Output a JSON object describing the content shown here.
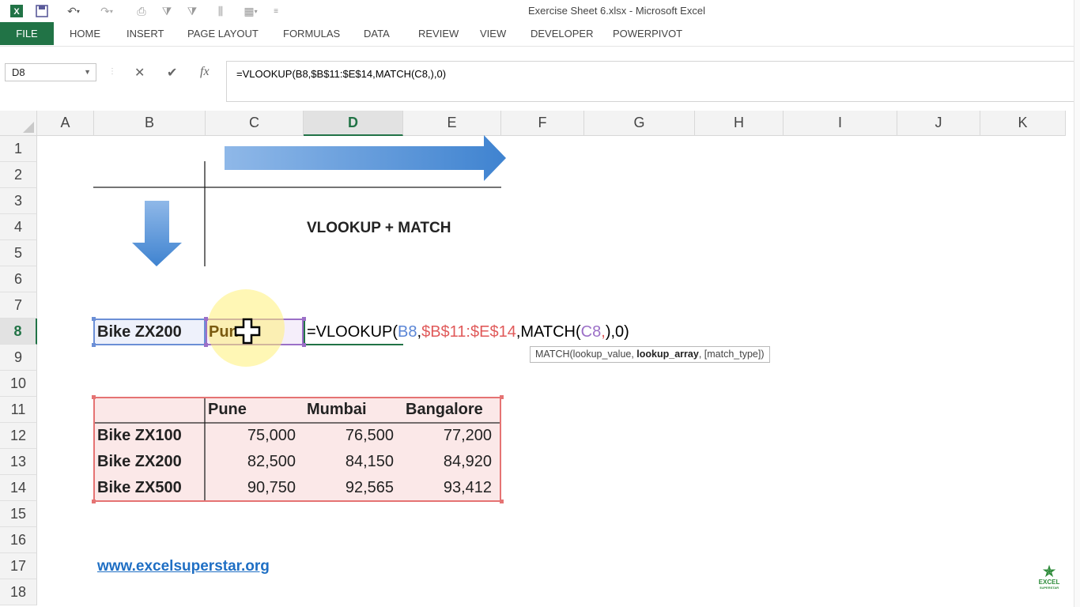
{
  "window": {
    "title": "Exercise Sheet 6.xlsx - Microsoft Excel"
  },
  "ribbon": {
    "file_label": "FILE",
    "tabs": [
      "HOME",
      "INSERT",
      "PAGE LAYOUT",
      "FORMULAS",
      "DATA",
      "REVIEW",
      "VIEW",
      "DEVELOPER",
      "POWERPIVOT"
    ]
  },
  "formula_bar": {
    "name_box": "D8",
    "formula": "=VLOOKUP(B8,$B$11:$E$14,MATCH(C8,),0)"
  },
  "columns": [
    "A",
    "B",
    "C",
    "D",
    "E",
    "F",
    "G",
    "H",
    "I",
    "J",
    "K"
  ],
  "rows": [
    "1",
    "2",
    "3",
    "4",
    "5",
    "6",
    "7",
    "8",
    "9",
    "10",
    "11",
    "12",
    "13",
    "14",
    "15",
    "16",
    "17",
    "18"
  ],
  "selected_column": "D",
  "selected_row": "8",
  "sheet": {
    "heading": "VLOOKUP + MATCH",
    "b8": "Bike ZX200",
    "c8": "Pun",
    "d8_formula_parts": [
      {
        "text": "=VLOOKUP(",
        "color": "#000000"
      },
      {
        "text": "B8",
        "color": "#5b86d6"
      },
      {
        "text": ",",
        "color": "#000000"
      },
      {
        "text": "$B$11:$E$14",
        "color": "#e05a5a"
      },
      {
        "text": ",MATCH(",
        "color": "#000000"
      },
      {
        "text": "C8",
        "color": "#9b6fc7"
      },
      {
        "text": ",",
        "color": "#e05a5a"
      },
      {
        "text": ")",
        "color": "#000000"
      },
      {
        "text": ",0)",
        "color": "#000000"
      }
    ],
    "table_headers": [
      "Pune",
      "Mumbai",
      "Bangalore"
    ],
    "table_rows": [
      {
        "label": "Bike ZX100",
        "values": [
          "75,000",
          "76,500",
          "77,200"
        ]
      },
      {
        "label": "Bike ZX200",
        "values": [
          "82,500",
          "84,150",
          "84,920"
        ]
      },
      {
        "label": "Bike ZX500",
        "values": [
          "90,750",
          "92,565",
          "93,412"
        ]
      }
    ],
    "link": "www.excelsuperstar.org"
  },
  "tooltip": {
    "prefix": "MATCH(lookup_value, ",
    "bold": "lookup_array",
    "suffix": ", [match_type])"
  },
  "logo": {
    "line1": "EXCEL",
    "line2": "SUPERSTAR"
  },
  "colors": {
    "excel_green": "#217346",
    "arrow_blue": "#4f8fd6",
    "table_border": "#e57373",
    "table_fill": "#fbe8e8"
  }
}
